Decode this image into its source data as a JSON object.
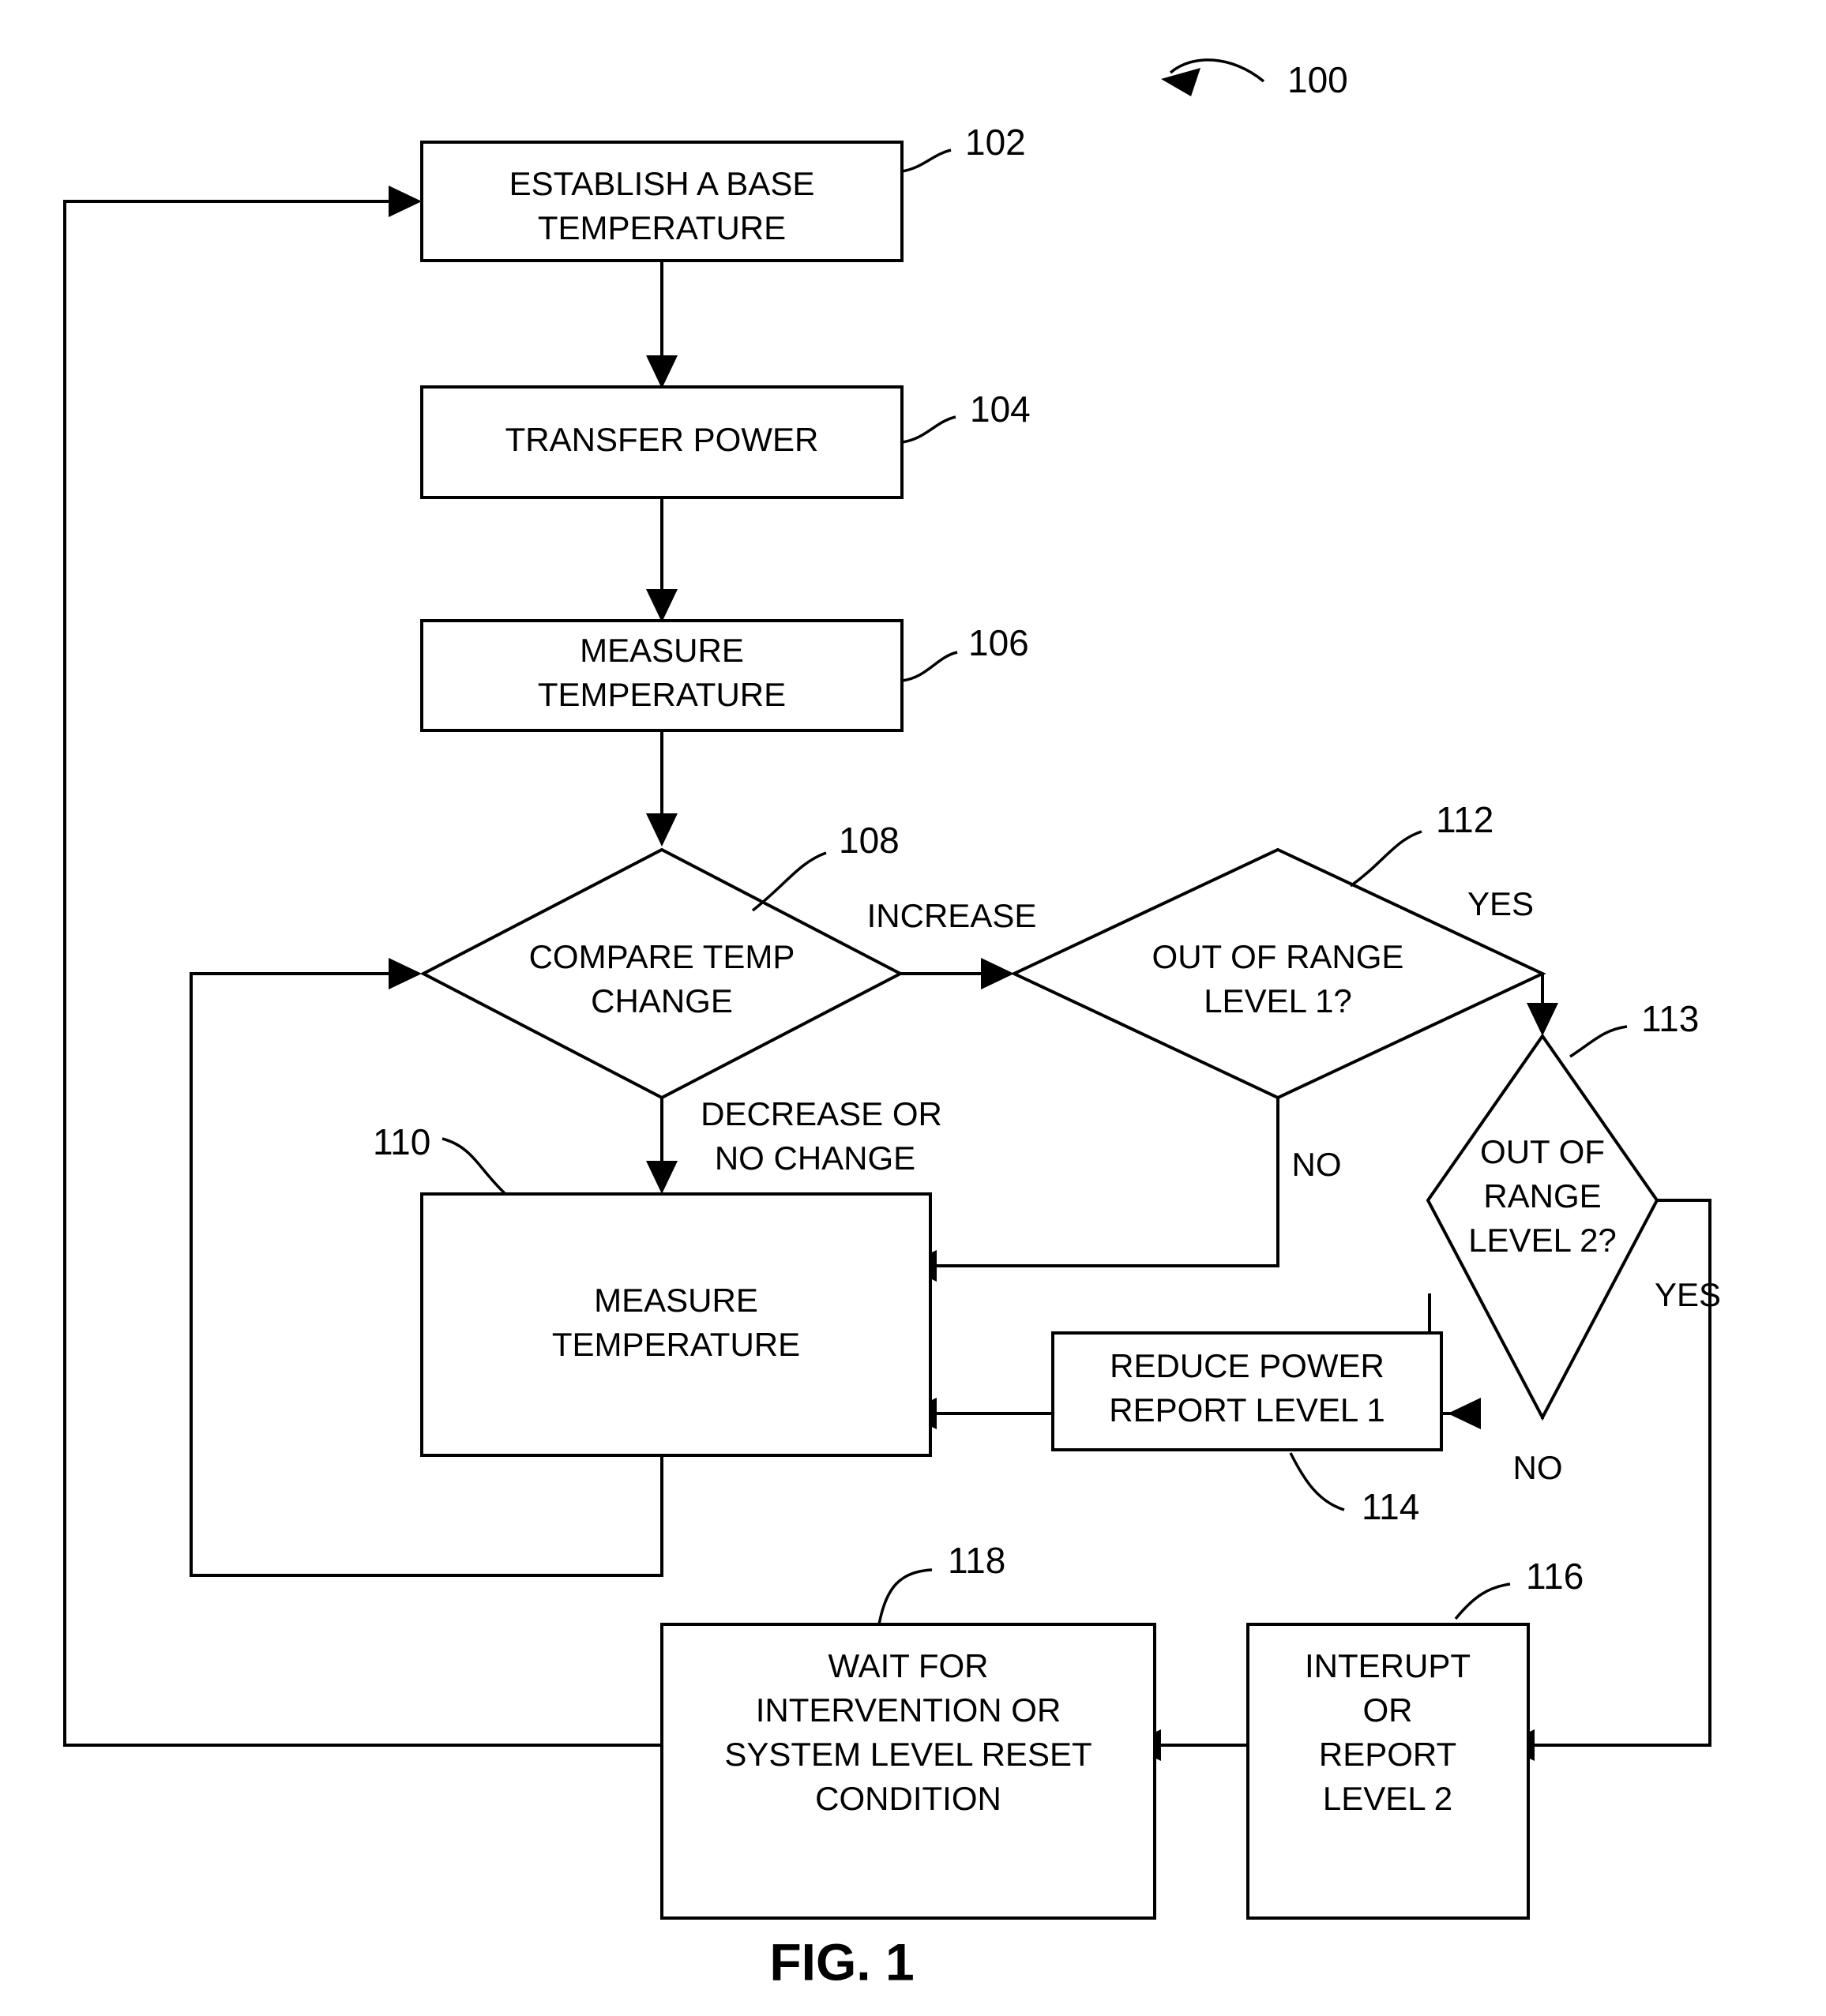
{
  "figure": {
    "caption": "FIG. 1",
    "diagram_ref": "100"
  },
  "nodes": [
    {
      "id": "n102",
      "ref": "102",
      "shape": "process",
      "lines": [
        "ESTABLISH A BASE",
        "TEMPERATURE"
      ]
    },
    {
      "id": "n104",
      "ref": "104",
      "shape": "process",
      "lines": [
        "TRANSFER POWER"
      ]
    },
    {
      "id": "n106",
      "ref": "106",
      "shape": "process",
      "lines": [
        "MEASURE",
        "TEMPERATURE"
      ]
    },
    {
      "id": "n108",
      "ref": "108",
      "shape": "decision",
      "lines": [
        "COMPARE TEMP",
        "CHANGE"
      ]
    },
    {
      "id": "n110",
      "ref": "110",
      "shape": "process",
      "lines": [
        "MEASURE",
        "TEMPERATURE"
      ]
    },
    {
      "id": "n112",
      "ref": "112",
      "shape": "decision",
      "lines": [
        "OUT OF RANGE",
        "LEVEL 1?"
      ]
    },
    {
      "id": "n113",
      "ref": "113",
      "shape": "decision",
      "lines": [
        "OUT OF",
        "RANGE",
        "LEVEL 2?"
      ]
    },
    {
      "id": "n114",
      "ref": "114",
      "shape": "process",
      "lines": [
        "REDUCE POWER",
        "REPORT LEVEL 1"
      ]
    },
    {
      "id": "n116",
      "ref": "116",
      "shape": "process",
      "lines": [
        "INTERUPT",
        "OR",
        "REPORT",
        "LEVEL 2"
      ]
    },
    {
      "id": "n118",
      "ref": "118",
      "shape": "process",
      "lines": [
        "WAIT FOR",
        "INTERVENTION OR",
        "SYSTEM LEVEL RESET",
        "CONDITION"
      ]
    }
  ],
  "edge_labels": {
    "increase": "INCREASE",
    "decrease_or_no_change_1": "DECREASE OR",
    "decrease_or_no_change_2": "NO CHANGE",
    "yes_level1": "YES",
    "no_level1": "NO",
    "yes_level2": "YES",
    "no_level2": "NO"
  },
  "colors": {
    "line": "#000000",
    "fill": "#ffffff",
    "text": "#000000"
  }
}
